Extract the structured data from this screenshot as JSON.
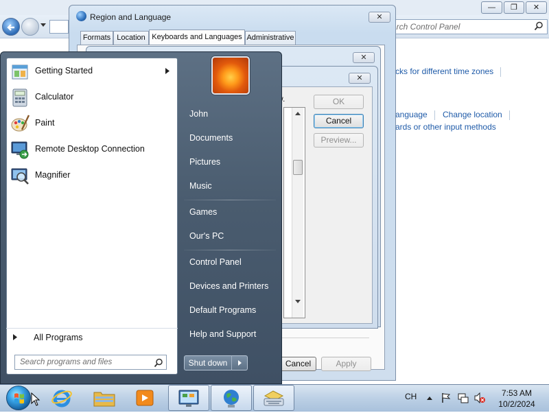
{
  "control_panel": {
    "search_placeholder": "arch Control Panel",
    "links": {
      "time_zones": "cks for different time zones",
      "change_language": "anguage",
      "change_location": "Change location",
      "keyboards": "ards or other input methods"
    },
    "window_controls": {
      "minimize": "—",
      "maximize": "❐",
      "close": "✕"
    }
  },
  "region_dialog": {
    "title": "Region and Language",
    "close": "✕",
    "tabs": [
      "Formats",
      "Location",
      "Keyboards and Languages",
      "Administrative"
    ],
    "active_tab": "Keyboards and Languages",
    "bottom_buttons": {
      "cancel": "Cancel",
      "apply": "Apply"
    }
  },
  "sub_dialog": {
    "close1": "✕",
    "close2": "✕",
    "text_fragment": "w.",
    "buttons": {
      "ok": "OK",
      "cancel": "Cancel",
      "preview": "Preview..."
    }
  },
  "start_menu": {
    "programs": [
      {
        "label": "Getting Started",
        "icon": "getting-started-icon",
        "has_arrow": true
      },
      {
        "label": "Calculator",
        "icon": "calculator-icon"
      },
      {
        "label": "Paint",
        "icon": "paint-icon"
      },
      {
        "label": "Remote Desktop Connection",
        "icon": "remote-desktop-icon"
      },
      {
        "label": "Magnifier",
        "icon": "magnifier-icon"
      }
    ],
    "all_programs": "All Programs",
    "search_placeholder": "Search programs and files",
    "right_items": [
      "John",
      "Documents",
      "Pictures",
      "Music",
      "Games",
      "Our's PC",
      "Control Panel",
      "Devices and Printers",
      "Default Programs",
      "Help and Support"
    ],
    "shutdown": "Shut down"
  },
  "taskbar": {
    "pinned": [
      "internet-explorer-icon",
      "windows-explorer-icon",
      "media-player-icon"
    ],
    "running": [
      "control-panel-task-icon",
      "region-language-task-icon",
      "keyboard-task-icon"
    ],
    "language": "CH",
    "time": "7:53 AM",
    "date": "10/2/2024"
  }
}
